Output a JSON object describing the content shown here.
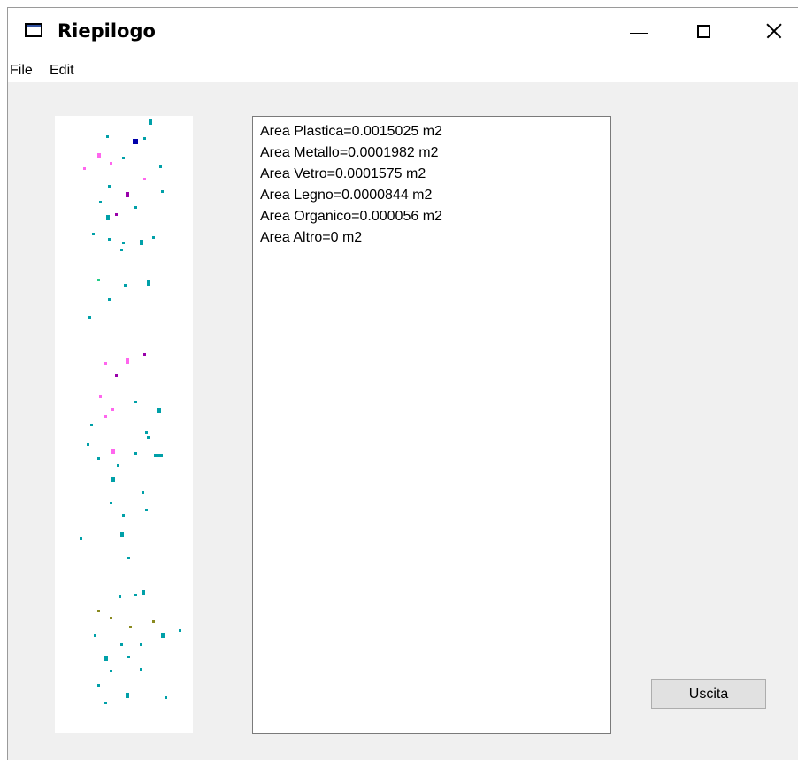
{
  "window": {
    "title": "Riepilogo",
    "icon": "window-app-icon",
    "controls": [
      "minimize-icon",
      "maximize-icon",
      "close-icon"
    ]
  },
  "menu": {
    "file": "File",
    "edit": "Edit"
  },
  "summary": {
    "items": [
      "Area Plastica=0.0015025 m2",
      "Area Metallo=0.0001982 m2",
      "Area Vetro=0.0001575 m2",
      "Area Legno=0.0000844 m2",
      "Area Organico=0.000056 m2",
      "Area Altro=0 m2"
    ]
  },
  "buttons": {
    "exit": "Uscita"
  },
  "colors": {
    "plastic_cyan": "#00a0a8",
    "pink": "#ff66ee",
    "purple": "#9900aa",
    "blue": "#0000aa",
    "green": "#22cc88",
    "olive": "#8a8a20"
  }
}
